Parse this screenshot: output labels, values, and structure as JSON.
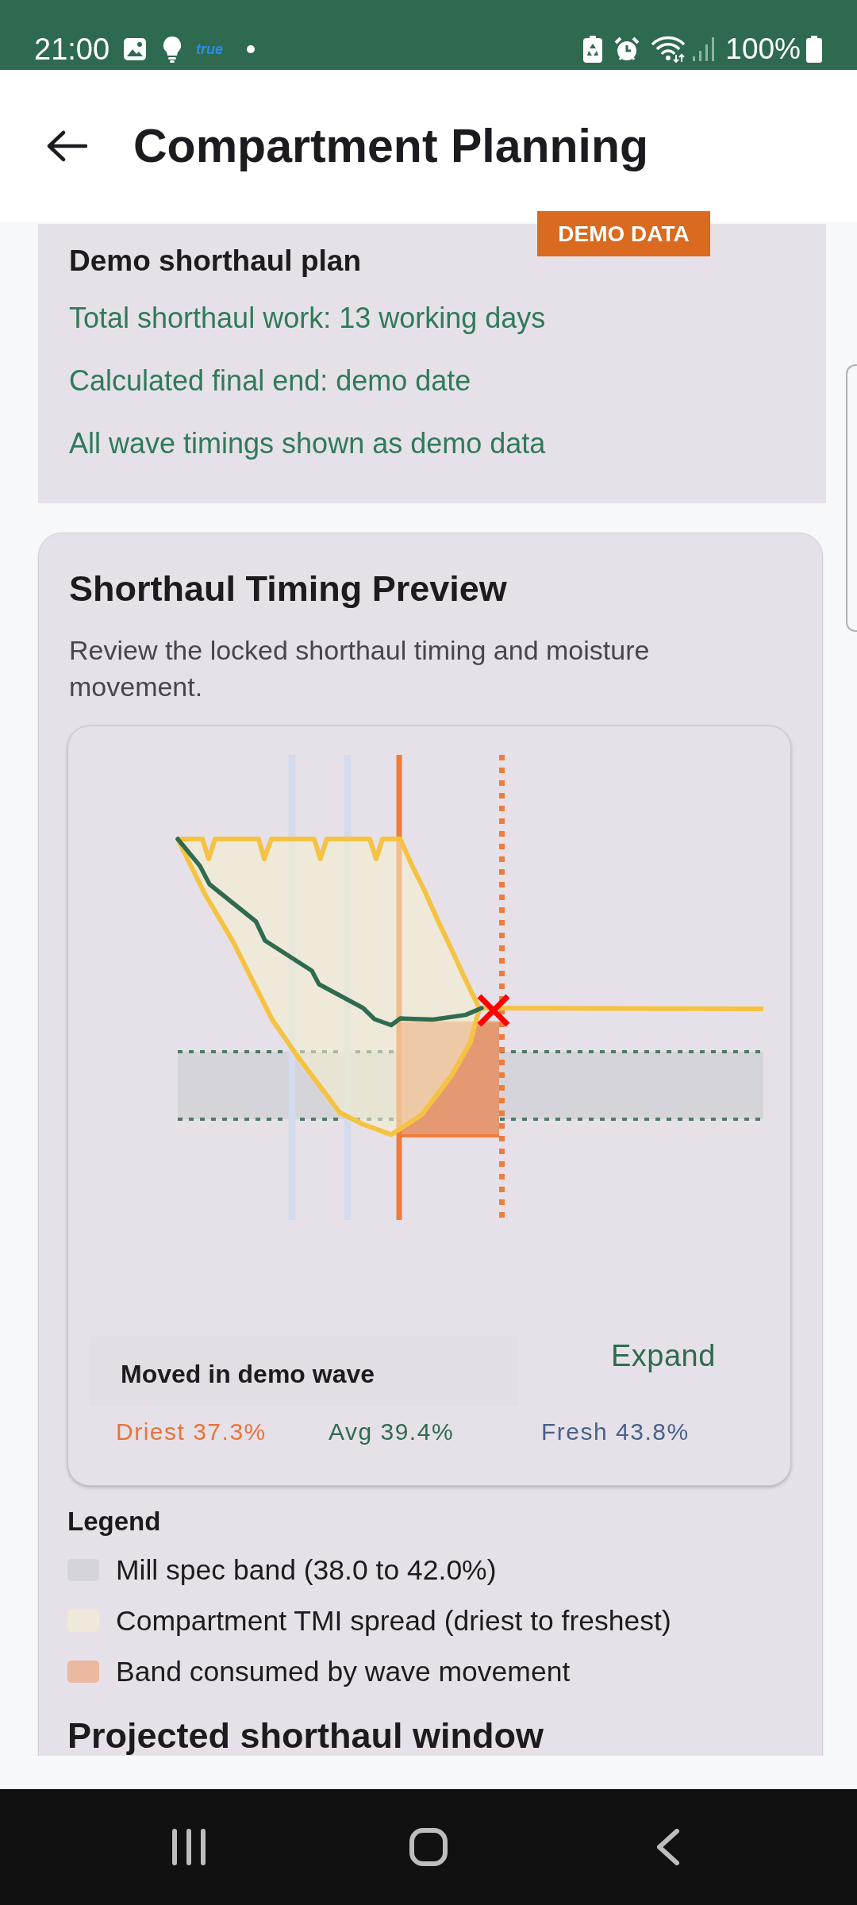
{
  "status_bar": {
    "time": "21:00",
    "notification_label": "true",
    "battery": "100%"
  },
  "app_bar": {
    "title": "Compartment Planning"
  },
  "plan_summary": {
    "badge": "DEMO DATA",
    "title": "Demo shorthaul plan",
    "lines": [
      "Total shorthaul work: 13 working days",
      "Calculated final end: demo date",
      "All wave timings shown as demo data"
    ]
  },
  "timing_preview": {
    "title": "Shorthaul Timing Preview",
    "description": "Review the locked shorthaul timing and moisture movement.",
    "summary": {
      "title": "Moved in demo wave",
      "expand_label": "Expand",
      "stats": [
        {
          "kind": "driest",
          "text": "Driest 37.3%"
        },
        {
          "kind": "average",
          "text": "Avg 39.4%"
        },
        {
          "kind": "fresh",
          "text": "Fresh 43.8%"
        }
      ]
    },
    "legend": {
      "title": "Legend",
      "items": [
        {
          "label": "Mill spec band (38.0 to 42.0%)",
          "color": "#d5d4da"
        },
        {
          "label": "Compartment TMI spread (driest to freshest)",
          "color": "#efe9dc"
        },
        {
          "label": "Band consumed by wave movement",
          "color": "#ebb8a2"
        }
      ]
    }
  },
  "next_section": {
    "title": "Projected shorthaul window"
  }
}
